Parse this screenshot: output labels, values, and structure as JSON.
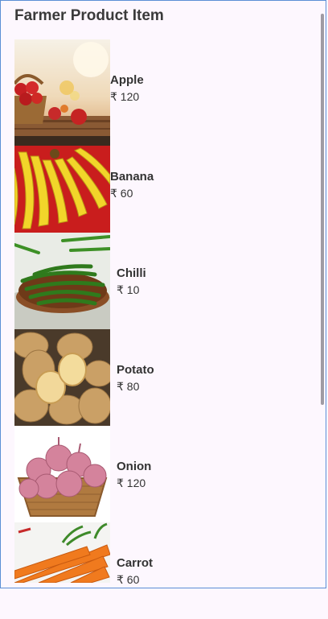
{
  "app": {
    "title": "Farmer Product Item"
  },
  "colors": {
    "background": "#fdf7fe",
    "text": "#333333",
    "scrollbar": "#9f9aa3"
  },
  "products": [
    {
      "name": "Apple",
      "price": "₹ 120",
      "image": "apple-basket-image"
    },
    {
      "name": "Banana",
      "price": "₹ 60",
      "image": "banana-bunch-image"
    },
    {
      "name": "Chilli",
      "price": "₹ 10",
      "image": "green-chilli-bowl-image"
    },
    {
      "name": "Potato",
      "price": "₹ 80",
      "image": "potatoes-image"
    },
    {
      "name": "Onion",
      "price": "₹ 120",
      "image": "onion-basket-image"
    },
    {
      "name": "Carrot",
      "price": "₹ 60",
      "image": "carrots-image"
    }
  ]
}
